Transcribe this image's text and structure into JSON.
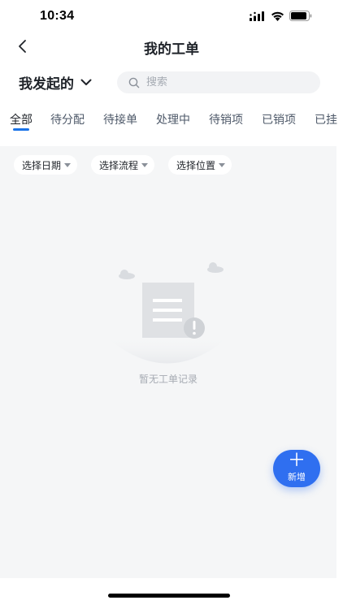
{
  "status_bar": {
    "time": "10:34"
  },
  "nav": {
    "title": "我的工单"
  },
  "scope": {
    "label": "我发起的"
  },
  "search": {
    "placeholder": "搜索"
  },
  "tabs": [
    {
      "label": "全部",
      "active": true
    },
    {
      "label": "待分配"
    },
    {
      "label": "待接单"
    },
    {
      "label": "处理中"
    },
    {
      "label": "待销项"
    },
    {
      "label": "已销项"
    },
    {
      "label": "已挂"
    }
  ],
  "filters": [
    {
      "label": "选择日期"
    },
    {
      "label": "选择流程"
    },
    {
      "label": "选择位置"
    }
  ],
  "empty_state": {
    "text": "暂无工单记录"
  },
  "fab": {
    "label": "新增",
    "icon": "plus-icon"
  },
  "colors": {
    "accent": "#2f6ff0",
    "tab_indicator": "#1a73e8",
    "content_bg": "#f5f6f7"
  }
}
